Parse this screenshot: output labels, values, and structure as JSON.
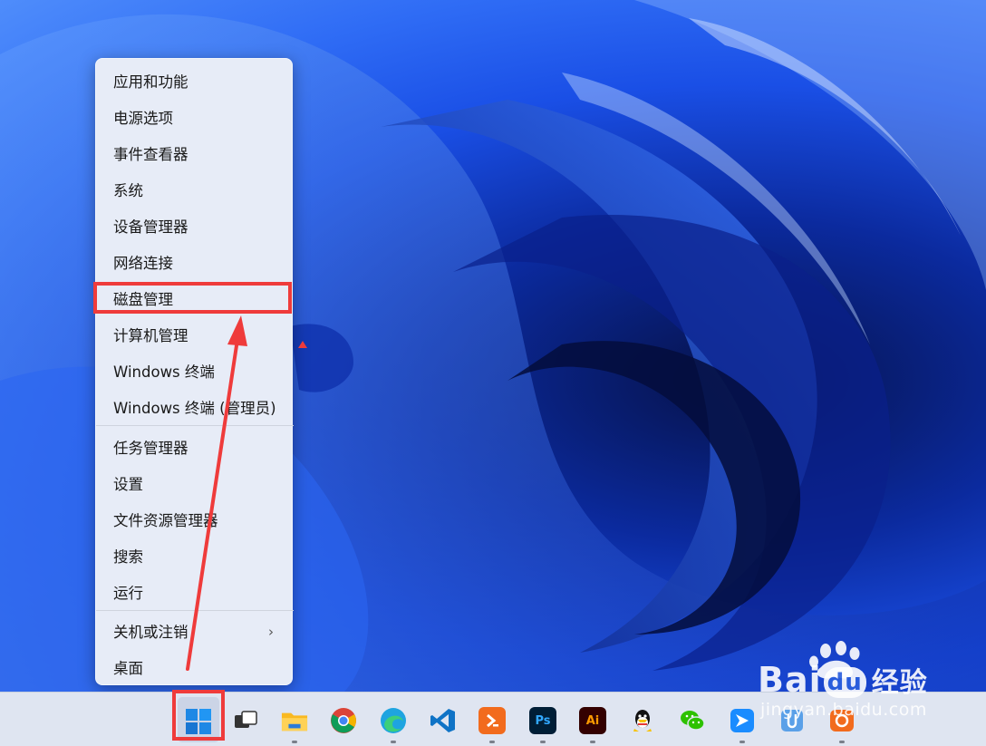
{
  "menu": {
    "items": [
      {
        "label": "应用和功能"
      },
      {
        "label": "电源选项"
      },
      {
        "label": "事件查看器"
      },
      {
        "label": "系统"
      },
      {
        "label": "设备管理器"
      },
      {
        "label": "网络连接"
      },
      {
        "label": "磁盘管理"
      },
      {
        "label": "计算机管理"
      },
      {
        "label": "Windows 终端"
      },
      {
        "label": "Windows 终端 (管理员)"
      },
      {
        "label": "任务管理器"
      },
      {
        "label": "设置"
      },
      {
        "label": "文件资源管理器"
      },
      {
        "label": "搜索"
      },
      {
        "label": "运行"
      },
      {
        "label": "关机或注销"
      },
      {
        "label": "桌面"
      }
    ],
    "submenu_chevron": "›"
  },
  "taskbar": {
    "ps_label": "Ps",
    "ai_label": "Ai"
  },
  "watermark": {
    "brand": "Bai",
    "du": "du",
    "cn": "经验",
    "url": "jingyan.baidu.com"
  },
  "colors": {
    "highlight": "#ef3b3b",
    "menu_bg": "#e7ecf7",
    "taskbar_bg": "#dfe5f1"
  }
}
